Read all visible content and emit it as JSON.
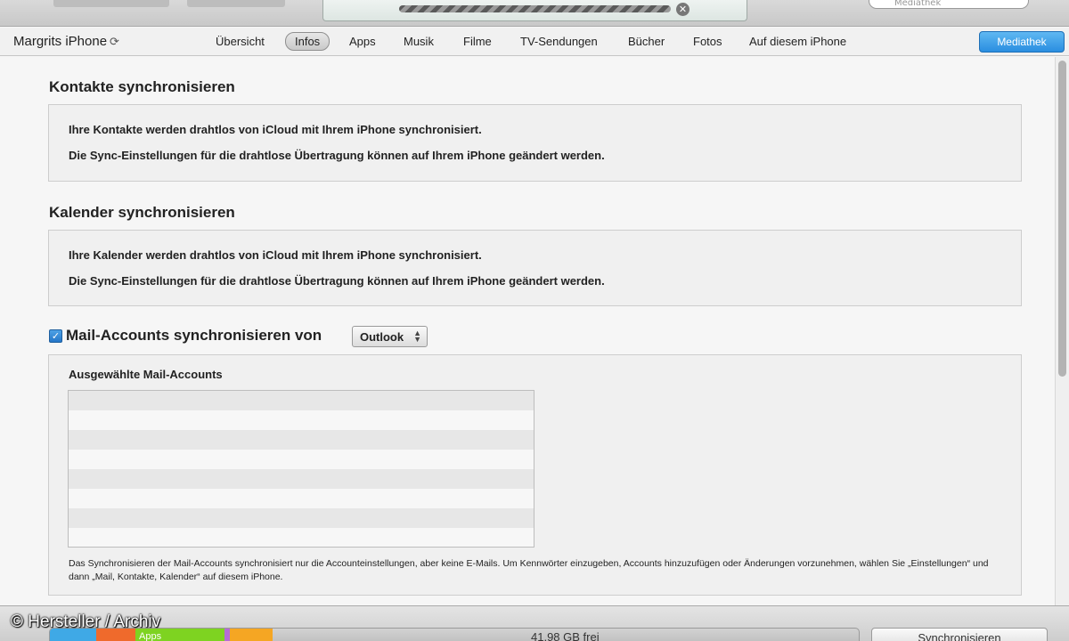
{
  "toolbar": {
    "search_placeholder": "Mediathek"
  },
  "device": {
    "name": "Margrits iPhone",
    "tabs": [
      {
        "label": "Übersicht"
      },
      {
        "label": "Infos"
      },
      {
        "label": "Apps"
      },
      {
        "label": "Musik"
      },
      {
        "label": "Filme"
      },
      {
        "label": "TV-Sendungen"
      },
      {
        "label": "Bücher"
      },
      {
        "label": "Fotos"
      },
      {
        "label": "Auf diesem iPhone"
      }
    ],
    "active_tab": "Infos",
    "library_button": "Mediathek"
  },
  "contacts": {
    "title": "Kontakte synchronisieren",
    "line1": "Ihre Kontakte werden drahtlos von iCloud mit Ihrem iPhone synchronisiert.",
    "line2": "Die Sync-Einstellungen für die drahtlose Übertragung können auf Ihrem iPhone geändert werden."
  },
  "calendar": {
    "title": "Kalender synchronisieren",
    "line1": "Ihre Kalender werden drahtlos von iCloud mit Ihrem iPhone synchronisiert.",
    "line2": "Die Sync-Einstellungen für die drahtlose Übertragung können auf Ihrem iPhone geändert werden."
  },
  "mail": {
    "checked": true,
    "title": "Mail-Accounts synchronisieren von",
    "source": "Outlook",
    "accounts_label": "Ausgewählte Mail-Accounts",
    "accounts": [],
    "note": "Das Synchronisieren der Mail-Accounts synchronisiert nur die Accounteinstellungen, aber keine E-Mails. Um Kennwörter einzugeben, Accounts hinzuzufügen oder Änderungen vorzunehmen, wählen Sie „Einstellungen“ und dann „Mail, Kontakte, Kalender“ auf diesem iPhone."
  },
  "capacity": {
    "apps_label": "Apps",
    "free_label": "41,98 GB frei"
  },
  "sync_button": "Synchronisieren",
  "watermark": "© Hersteller / Archiv",
  "colors": {
    "library_button": "#2a8ee0",
    "seg_audio": "#3fa9e6",
    "seg_photos": "#ef6a2c",
    "seg_apps": "#7ed321",
    "seg_books": "#b56cd6",
    "seg_other": "#f5a623"
  },
  "icons": {
    "sync": "sync-icon",
    "checkbox": "checkmark-icon",
    "close": "close-icon",
    "search": "search-icon",
    "select": "updown-arrows-icon"
  }
}
